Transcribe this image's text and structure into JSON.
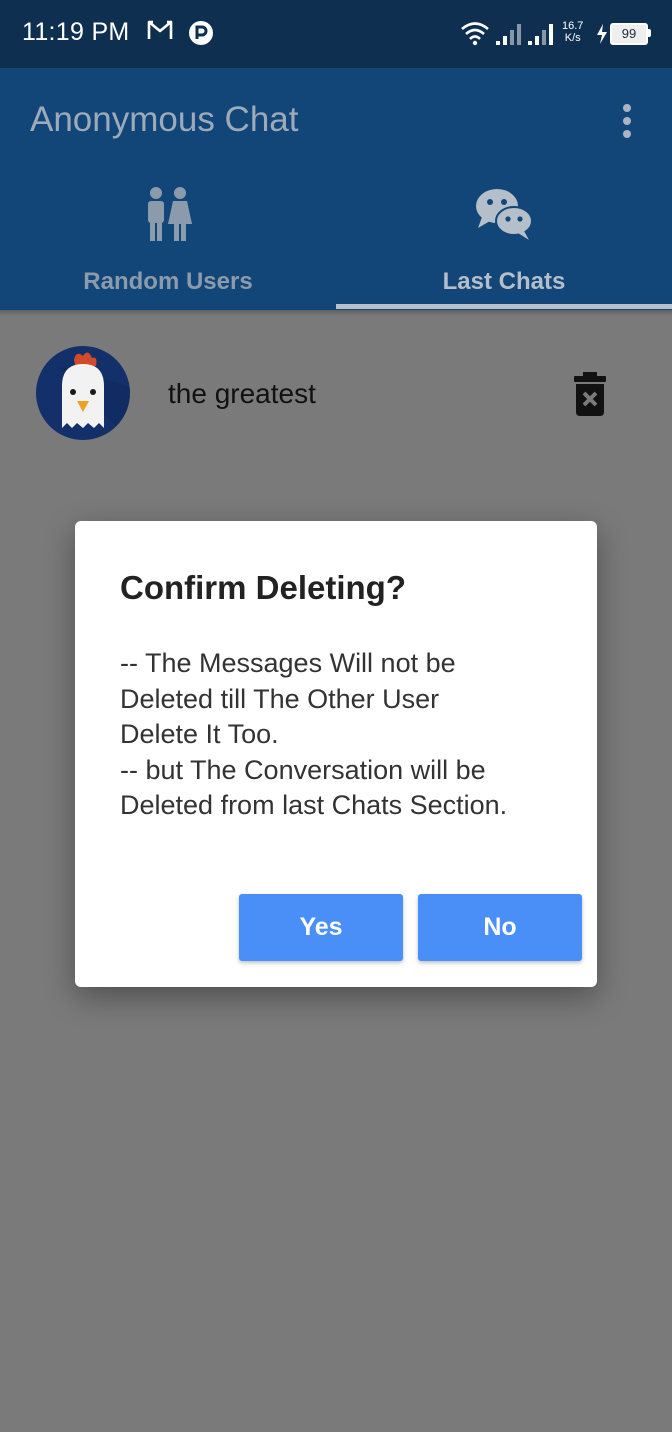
{
  "status_bar": {
    "time": "11:19 PM",
    "net_speed_value": "16.7",
    "net_speed_unit": "K/s",
    "battery": "99"
  },
  "app_bar": {
    "title": "Anonymous Chat",
    "tabs": [
      {
        "label": "Random Users",
        "icon": "people-icon",
        "selected": false
      },
      {
        "label": "Last Chats",
        "icon": "wechat-icon",
        "selected": true
      }
    ]
  },
  "chats": [
    {
      "name": "the greatest",
      "avatar": "chicken-avatar"
    }
  ],
  "dialog": {
    "title": "Confirm Deleting?",
    "message": "-- The Messages Will not be\nDeleted till The Other User\nDelete It Too.\n-- but The Conversation will be\nDeleted from last Chats Section.",
    "yes_label": "Yes",
    "no_label": "No"
  },
  "colors": {
    "status_bar": "#0e2f50",
    "app_bar": "#124679",
    "scrim": "#7a7a7a",
    "button": "#4a8ff7"
  }
}
